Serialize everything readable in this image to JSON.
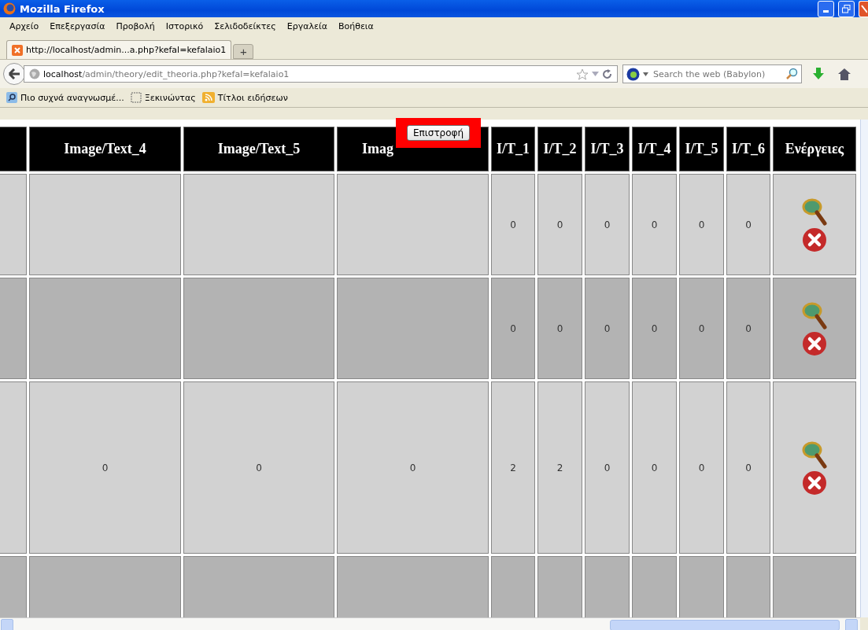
{
  "window": {
    "title": "Mozilla Firefox"
  },
  "menu": [
    "Αρχείο",
    "Επεξεργασία",
    "Προβολή",
    "Ιστορικό",
    "Σελιδοδείκτες",
    "Εργαλεία",
    "Βοήθεια"
  ],
  "tabs": [
    {
      "label": "http://localhost/admin...a.php?kefal=kefalaio1",
      "selected": true
    }
  ],
  "new_tab": "+",
  "address": {
    "host": "localhost",
    "path": "/admin/theory/edit_theoria.php?kefal=kefalaio1"
  },
  "search": {
    "placeholder": "Search the web (Babylon)"
  },
  "bookmarks": [
    {
      "label": "Πιο συχνά αναγνωσμέ...",
      "kind": "search"
    },
    {
      "label": "Ξεκινώντας",
      "kind": "blank"
    },
    {
      "label": "Τίτλοι ειδήσεων",
      "kind": "feed"
    }
  ],
  "back_button": "Επιστροφή",
  "table": {
    "columns": [
      "Image/Text_4",
      "Image/Text_5",
      "Imag",
      "I/T_1",
      "I/T_2",
      "I/T_3",
      "I/T_4",
      "I/T_5",
      "I/T_6",
      "Ενέργειες"
    ],
    "rows": [
      {
        "shaded": false,
        "actions": true,
        "it": [
          "0",
          "0",
          "0",
          "0",
          "0",
          "0"
        ]
      },
      {
        "shaded": true,
        "actions": true,
        "it": [
          "0",
          "0",
          "0",
          "0",
          "0",
          "0"
        ]
      },
      {
        "shaded": false,
        "actions": true,
        "image_text": [
          "0",
          "0",
          "0"
        ],
        "it": [
          "2",
          "2",
          "0",
          "0",
          "0",
          "0"
        ]
      },
      {
        "shaded": true,
        "actions": false
      }
    ]
  }
}
